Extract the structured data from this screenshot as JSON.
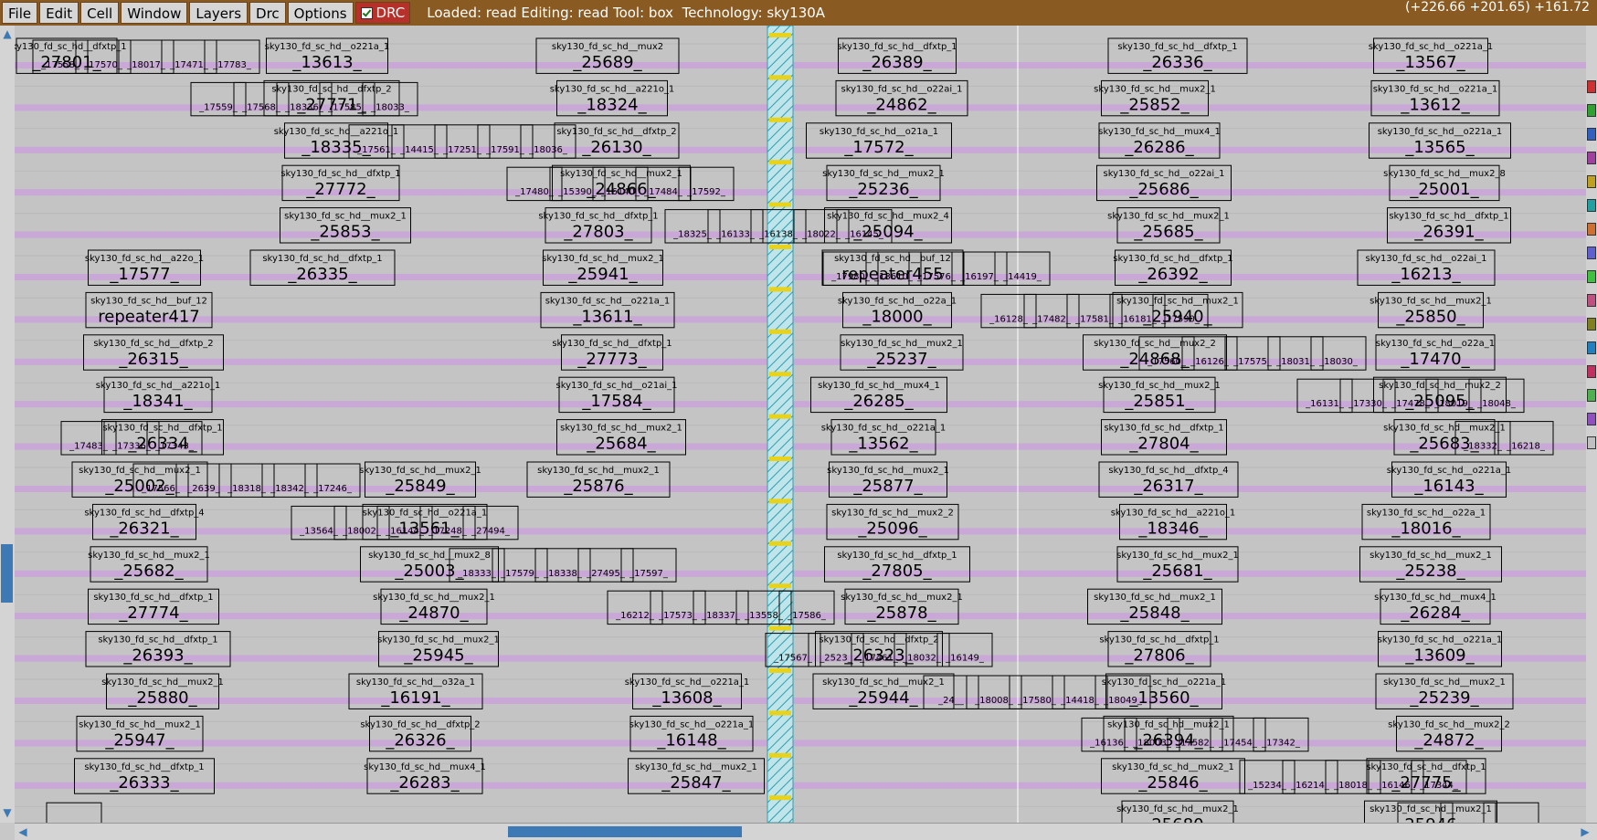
{
  "menu": {
    "items": [
      "File",
      "Edit",
      "Cell",
      "Window",
      "Layers",
      "Drc",
      "Options"
    ],
    "drc_label": "DRC",
    "drc_checked": true
  },
  "status": {
    "text": "Loaded: read Editing: read Tool: box  Technology: sky130A",
    "coords": "(+226.66 +201.65) +161.72"
  },
  "colors": {
    "menubar": "#8a5a23",
    "drc_button": "#b8302a",
    "stripe": "#c9a7d6",
    "cell_outline": "#000000",
    "background": "#c4c4c4",
    "hatch": "#46b8c8",
    "scroll_thumb": "#3d79b5"
  },
  "cells": [
    {
      "name": "sky130_fd_sc_hd__dfxtp_1",
      "num": "_27801_"
    },
    {
      "name": "sky130_fd_sc_hd__o221a_1",
      "num": "_13613_"
    },
    {
      "name": "sky130_fd_sc_hd__mux2",
      "num": "_25689_"
    },
    {
      "name": "sky130_fd_sc_hd__dfxtp_1",
      "num": "_26389_"
    },
    {
      "name": "sky130_fd_sc_hd__dfxtp_1",
      "num": "_26336_"
    },
    {
      "name": "sky130_fd_sc_hd__o221a_1",
      "num": "_13567_"
    },
    {
      "name": "sky130_fd_sc_hd__dfxtp_2",
      "num": "_27771_"
    },
    {
      "name": "sky130_fd_sc_hd__a221o_1",
      "num": "_18324_"
    },
    {
      "name": "sky130_fd_sc_hd__o22ai_1",
      "num": "_24862_"
    },
    {
      "name": "sky130_fd_sc_hd__mux2_1",
      "num": "_25852_"
    },
    {
      "name": "sky130_fd_sc_hd__o221a_1",
      "num": "_13612_"
    },
    {
      "name": "sky130_fd_sc_hd__a221o_1",
      "num": "_18335_"
    },
    {
      "name": "sky130_fd_sc_hd__dfxtp_2",
      "num": "_26130_"
    },
    {
      "name": "sky130_fd_sc_hd__o21a_1",
      "num": "_17572_"
    },
    {
      "name": "sky130_fd_sc_hd__mux4_1",
      "num": "_26286_"
    },
    {
      "name": "sky130_fd_sc_hd__o221a_1",
      "num": "_13565_"
    },
    {
      "name": "sky130_fd_sc_hd__dfxtp_1",
      "num": "_27772_"
    },
    {
      "name": "sky130_fd_sc_hd__mux2_1",
      "num": "_24866_"
    },
    {
      "name": "sky130_fd_sc_hd__mux2_1",
      "num": "_25236_"
    },
    {
      "name": "sky130_fd_sc_hd__o22ai_1",
      "num": "_25686_"
    },
    {
      "name": "sky130_fd_sc_hd__mux2_8",
      "num": "_25001_"
    },
    {
      "name": "sky130_fd_sc_hd__mux2_1",
      "num": "_25853_"
    },
    {
      "name": "sky130_fd_sc_hd__dfxtp_1",
      "num": "_27803_"
    },
    {
      "name": "sky130_fd_sc_hd__mux2_4",
      "num": "_25094_"
    },
    {
      "name": "sky130_fd_sc_hd__mux2_1",
      "num": "_25685_"
    },
    {
      "name": "sky130_fd_sc_hd__dfxtp_1",
      "num": "_26391_"
    },
    {
      "name": "sky130_fd_sc_hd__dfxtp_1",
      "num": "_26335_"
    },
    {
      "name": "sky130_fd_sc_hd__mux2_1",
      "num": "_25941_"
    },
    {
      "name": "sky130_fd_sc_hd__buf_12",
      "num": "repeater455"
    },
    {
      "name": "sky130_fd_sc_hd__dfxtp_1",
      "num": "_26392_"
    },
    {
      "name": "sky130_fd_sc_hd__o22ai_1",
      "num": "_16213_"
    },
    {
      "name": "sky130_fd_sc_hd__a22o_1",
      "num": "_17577_"
    },
    {
      "name": "sky130_fd_sc_hd__o221a_1",
      "num": "_13611_"
    },
    {
      "name": "sky130_fd_sc_hd__o22a_1",
      "num": "_18000_"
    },
    {
      "name": "sky130_fd_sc_hd__mux2_1",
      "num": "_25940_"
    },
    {
      "name": "sky130_fd_sc_hd__mux2_1",
      "num": "_25850_"
    },
    {
      "name": "sky130_fd_sc_hd__buf_12",
      "num": "repeater417"
    },
    {
      "name": "sky130_fd_sc_hd__dfxtp_1",
      "num": "_27773_"
    },
    {
      "name": "sky130_fd_sc_hd__mux2_1",
      "num": "_25237_"
    },
    {
      "name": "sky130_fd_sc_hd__mux2_2",
      "num": "_24868_"
    },
    {
      "name": "sky130_fd_sc_hd__o22a_1",
      "num": "_17470_"
    },
    {
      "name": "sky130_fd_sc_hd__dfxtp_2",
      "num": "_26315_"
    },
    {
      "name": "sky130_fd_sc_hd__o21ai_1",
      "num": "_17584_"
    },
    {
      "name": "sky130_fd_sc_hd__mux4_1",
      "num": "_26285_"
    },
    {
      "name": "sky130_fd_sc_hd__mux2_1",
      "num": "_25851_"
    },
    {
      "name": "sky130_fd_sc_hd__mux2_2",
      "num": "_25095_"
    },
    {
      "name": "sky130_fd_sc_hd__a221o_1",
      "num": "_18341_"
    },
    {
      "name": "sky130_fd_sc_hd__mux2_1",
      "num": "_25684_"
    },
    {
      "name": "sky130_fd_sc_hd__o221a_1",
      "num": "_13562_"
    },
    {
      "name": "sky130_fd_sc_hd__dfxtp_1",
      "num": "_27804_"
    },
    {
      "name": "sky130_fd_sc_hd__mux2_1",
      "num": "_25683_"
    },
    {
      "name": "sky130_fd_sc_hd__dfxtp_1",
      "num": "_26334_"
    },
    {
      "name": "sky130_fd_sc_hd__mux2_1",
      "num": "_25876_"
    },
    {
      "name": "sky130_fd_sc_hd__mux2_1",
      "num": "_25877_"
    },
    {
      "name": "sky130_fd_sc_hd__dfxtp_4",
      "num": "_26317_"
    },
    {
      "name": "sky130_fd_sc_hd__o221a_1",
      "num": "_16143_"
    },
    {
      "name": "sky130_fd_sc_hd__mux2_1",
      "num": "_25002_"
    },
    {
      "name": "sky130_fd_sc_hd__mux2_1",
      "num": "_25849_"
    },
    {
      "name": "sky130_fd_sc_hd__mux2_2",
      "num": "_25096_"
    },
    {
      "name": "sky130_fd_sc_hd__a221o_1",
      "num": "_18346_"
    },
    {
      "name": "sky130_fd_sc_hd__o22a_1",
      "num": "_18016_"
    },
    {
      "name": "sky130_fd_sc_hd__dfxtp_4",
      "num": "_26321_"
    },
    {
      "name": "sky130_fd_sc_hd__o221a_1",
      "num": "_13561_"
    },
    {
      "name": "sky130_fd_sc_hd__dfxtp_1",
      "num": "_27805_"
    },
    {
      "name": "sky130_fd_sc_hd__mux2_1",
      "num": "_25681_"
    },
    {
      "name": "sky130_fd_sc_hd__mux2_1",
      "num": "_25238_"
    },
    {
      "name": "sky130_fd_sc_hd__mux2_1",
      "num": "_25682_"
    },
    {
      "name": "sky130_fd_sc_hd__mux2_8",
      "num": "_25003_"
    },
    {
      "name": "sky130_fd_sc_hd__mux2_1",
      "num": "_25878_"
    },
    {
      "name": "sky130_fd_sc_hd__mux2_1",
      "num": "_25848_"
    },
    {
      "name": "sky130_fd_sc_hd__mux4_1",
      "num": "_26284_"
    },
    {
      "name": "sky130_fd_sc_hd__dfxtp_1",
      "num": "_27774_"
    },
    {
      "name": "sky130_fd_sc_hd__mux2_1",
      "num": "_24870_"
    },
    {
      "name": "sky130_fd_sc_hd__dfxtp_2",
      "num": "_26323_"
    },
    {
      "name": "sky130_fd_sc_hd__dfxtp_1",
      "num": "_27806_"
    },
    {
      "name": "sky130_fd_sc_hd__o221a_1",
      "num": "_13609_"
    },
    {
      "name": "sky130_fd_sc_hd__dfxtp_1",
      "num": "_26393_"
    },
    {
      "name": "sky130_fd_sc_hd__mux2_1",
      "num": "_25945_"
    },
    {
      "name": "sky130_fd_sc_hd__mux2_1",
      "num": "_25944_"
    },
    {
      "name": "sky130_fd_sc_hd__o221a_1",
      "num": "_13560_"
    },
    {
      "name": "sky130_fd_sc_hd__mux2_1",
      "num": "_25239_"
    },
    {
      "name": "sky130_fd_sc_hd__mux2_1",
      "num": "_25880_"
    },
    {
      "name": "sky130_fd_sc_hd__o32a_1",
      "num": "_16191_"
    },
    {
      "name": "sky130_fd_sc_hd__o221a_1",
      "num": "_13608_"
    },
    {
      "name": "sky130_fd_sc_hd__mux2_1",
      "num": "_26394_"
    },
    {
      "name": "sky130_fd_sc_hd__mux2_2",
      "num": "_24872_"
    },
    {
      "name": "sky130_fd_sc_hd__mux2_1",
      "num": "_25947_"
    },
    {
      "name": "sky130_fd_sc_hd__dfxtp_2",
      "num": "_26326_"
    },
    {
      "name": "sky130_fd_sc_hd__o221a_1",
      "num": "_16148_"
    },
    {
      "name": "sky130_fd_sc_hd__mux2_1",
      "num": "_25846_"
    },
    {
      "name": "sky130_fd_sc_hd__dfxtp_1",
      "num": "_27775_"
    },
    {
      "name": "sky130_fd_sc_hd__dfxtp_1",
      "num": "_26333_"
    },
    {
      "name": "sky130_fd_sc_hd__mux4_1",
      "num": "_26283_"
    },
    {
      "name": "sky130_fd_sc_hd__mux2_1",
      "num": "_25847_"
    },
    {
      "name": "sky130_fd_sc_hd__mux2_1",
      "num": "_25680_"
    },
    {
      "name": "sky130_fd_sc_hd__mux2_1",
      "num": "_25946_"
    }
  ],
  "small_labels": [
    "_17558_",
    "_17559_",
    "_17561_",
    "_17480_",
    "_18325_",
    "_17980_",
    "_16128_",
    "_17560_",
    "_16131_",
    "_18332_",
    "_17566_",
    "_13564_",
    "_18333_",
    "_16212_",
    "_17567_",
    "_24__",
    "_16136_",
    "_15234_",
    "_17571_",
    "_17570_",
    "_17568_",
    "_14415_",
    "_15390_",
    "_16133_",
    "_13610_",
    "_17482_",
    "_16126_",
    "_17330_",
    "_16218_",
    "_2639_",
    "_18002_",
    "_17579_",
    "_17573_",
    "_2523_",
    "_18008_",
    "_18003_",
    "_16214_",
    "_17574_",
    "_18017_",
    "_18336_",
    "_17251_",
    "_16140_",
    "_16138_",
    "_17576_",
    "_17581_",
    "_17575_",
    "_17478_",
    "_17483_",
    "_18318_",
    "_16144_",
    "_18338_",
    "_18337_",
    "_17461_",
    "_17580_",
    "_17582_",
    "_18018_",
    "_18343_",
    "_17471_",
    "_17585_",
    "_17591_",
    "_17484_",
    "_18022_",
    "_16197_",
    "_16181_",
    "_18031_",
    "_18019_",
    "_17336_",
    "_18342_",
    "_17248_",
    "_27495_",
    "_13558_",
    "_18032_",
    "_14418_",
    "_17454_",
    "_16146_",
    "_13559_",
    "_17783_",
    "_18033_",
    "_18036_",
    "_17592_",
    "_16145_",
    "_14419_",
    "_17590_",
    "_18030_",
    "_18048_",
    "_17343_",
    "_17246_",
    "_27494_",
    "_17597_",
    "_17586_",
    "_16149_",
    "_18049_",
    "_17342_",
    "_17344_"
  ]
}
